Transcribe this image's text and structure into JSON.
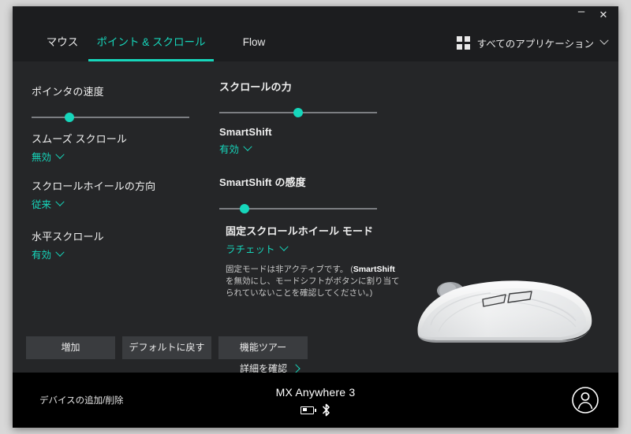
{
  "window": {
    "minimize_label": "–",
    "close_label": "✕"
  },
  "tabs": [
    {
      "label": "マウス",
      "active": false
    },
    {
      "label": "ポイント & スクロール",
      "active": true
    },
    {
      "label": "Flow",
      "active": false
    }
  ],
  "app_filter": {
    "icon": "grid-icon",
    "label": "すべてのアプリケーション",
    "caret": "chevron-down-icon"
  },
  "left_column": {
    "pointer_speed": {
      "label": "ポインタの速度",
      "slider_percent": 24
    },
    "smooth_scroll": {
      "label": "スムーズ スクロール",
      "value": "無効"
    },
    "scroll_wheel_direction": {
      "label": "スクロールホイールの方向",
      "value": "従来"
    },
    "horizontal_scroll": {
      "label": "水平スクロール",
      "value": "有効"
    }
  },
  "right_column": {
    "scroll_power": {
      "label": "スクロールの力",
      "slider_percent": 50
    },
    "smartshift": {
      "label": "SmartShift",
      "value": "有効"
    },
    "smartshift_sensitivity": {
      "label": "SmartShift の感度",
      "slider_percent": 16
    },
    "fixed_wheel_mode": {
      "label": "固定スクロールホイール モード",
      "value": "ラチェット",
      "note_prefix": "固定モードは非アクティブです。 (",
      "note_bold": "SmartShift",
      "note_suffix": " を無効にし、モードシフトがボタンに割り当てられていないことを確認してください。)"
    },
    "detail_link": {
      "label": "詳細を確認",
      "icon": "chevron-right-icon"
    }
  },
  "mouse_image": {
    "alt": "MX Anywhere 3 mouse side profile, pale grey"
  },
  "action_buttons": [
    {
      "label": "増加"
    },
    {
      "label": "デフォルトに戻す"
    },
    {
      "label": "機能ツアー"
    }
  ],
  "footer": {
    "add_remove_device": "デバイスの追加/削除",
    "device_name": "MX Anywhere 3",
    "battery_icon": "battery-icon",
    "bluetooth_icon": "bluetooth-icon",
    "avatar_icon": "user-avatar-icon"
  },
  "colors": {
    "accent": "#16d6bb",
    "background": "#252628",
    "titlebar": "#1c1d1f",
    "footer": "#000000",
    "button": "#3a3c3f"
  }
}
